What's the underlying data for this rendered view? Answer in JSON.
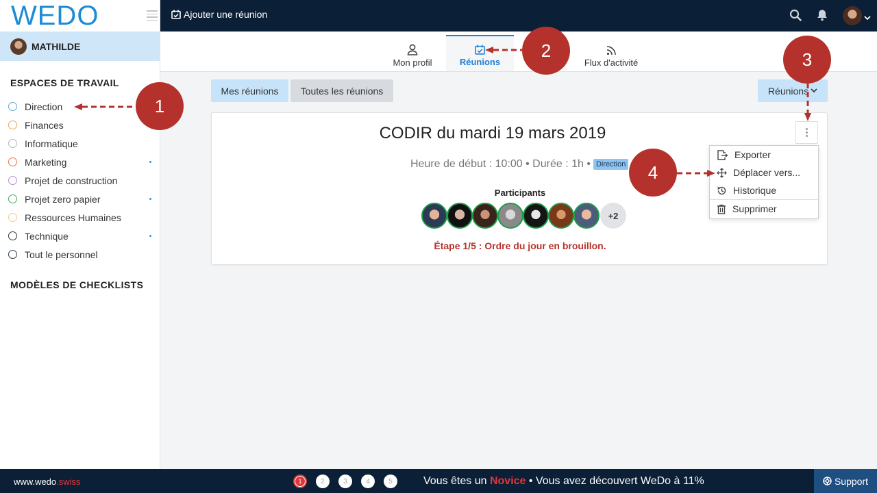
{
  "app": {
    "logo": "WEDO"
  },
  "sidebar": {
    "user_name": "MATHILDE",
    "workspaces_title": "ESPACES DE TRAVAIL",
    "workspaces": [
      {
        "label": "Direction",
        "color": "#5fa8d9",
        "dot": false
      },
      {
        "label": "Finances",
        "color": "#f0a356",
        "dot": false
      },
      {
        "label": "Informatique",
        "color": "#b5b5b5",
        "dot": false
      },
      {
        "label": "Marketing",
        "color": "#e07b3a",
        "dot": true
      },
      {
        "label": "Projet de construction",
        "color": "#b98cd4",
        "dot": false
      },
      {
        "label": "Projet zero papier",
        "color": "#3fae5a",
        "dot": true
      },
      {
        "label": "Ressources Humaines",
        "color": "#f5c88a",
        "dot": false
      },
      {
        "label": "Technique",
        "color": "#333333",
        "dot": true
      },
      {
        "label": "Tout le personnel",
        "color": "#2a3f5a",
        "dot": false
      }
    ],
    "templates_title": "MODÈLES DE CHECKLISTS"
  },
  "topbar": {
    "add_meeting_label": "Ajouter une réunion"
  },
  "tabs": [
    {
      "label": "Mon profil",
      "icon": "user-icon"
    },
    {
      "label": "Réunions",
      "icon": "calendar-check-icon",
      "active": true
    },
    {
      "label": "Flux d'activité",
      "icon": "rss-icon"
    }
  ],
  "filters": {
    "mine": "Mes réunions",
    "all": "Toutes les réunions",
    "meetings_dropdown": "Réunions"
  },
  "meeting": {
    "title": "CODIR du mardi 19 mars 2019",
    "subtitle": "Heure de début : 10:00 • Durée : 1h •",
    "workspace_badge": "Direction",
    "participants_label": "Participants",
    "more_participants": "+2",
    "step_text": "Étape 1/5 : Ordre du jour en brouillon."
  },
  "menu": {
    "items": [
      {
        "label": "Exporter",
        "icon": "export-icon"
      },
      {
        "label": "Déplacer vers...",
        "icon": "move-icon"
      },
      {
        "label": "Historique",
        "icon": "history-icon"
      },
      {
        "label": "Supprimer",
        "icon": "trash-icon"
      }
    ]
  },
  "callouts": [
    "1",
    "2",
    "3",
    "4"
  ],
  "bottom": {
    "site_prefix": "www.wedo",
    "site_suffix": ".swiss",
    "steps": [
      "1",
      "2",
      "3",
      "4",
      "5"
    ],
    "progress_prefix": "Vous êtes un ",
    "level": "Novice",
    "progress_suffix": " • Vous avez découvert WeDo à 11%",
    "support_label": "Support"
  },
  "colors": {
    "accent": "#1e7fd6",
    "topbar": "#0b1f36",
    "callout": "#b5322c",
    "participant_border": "#1e9c4a"
  }
}
